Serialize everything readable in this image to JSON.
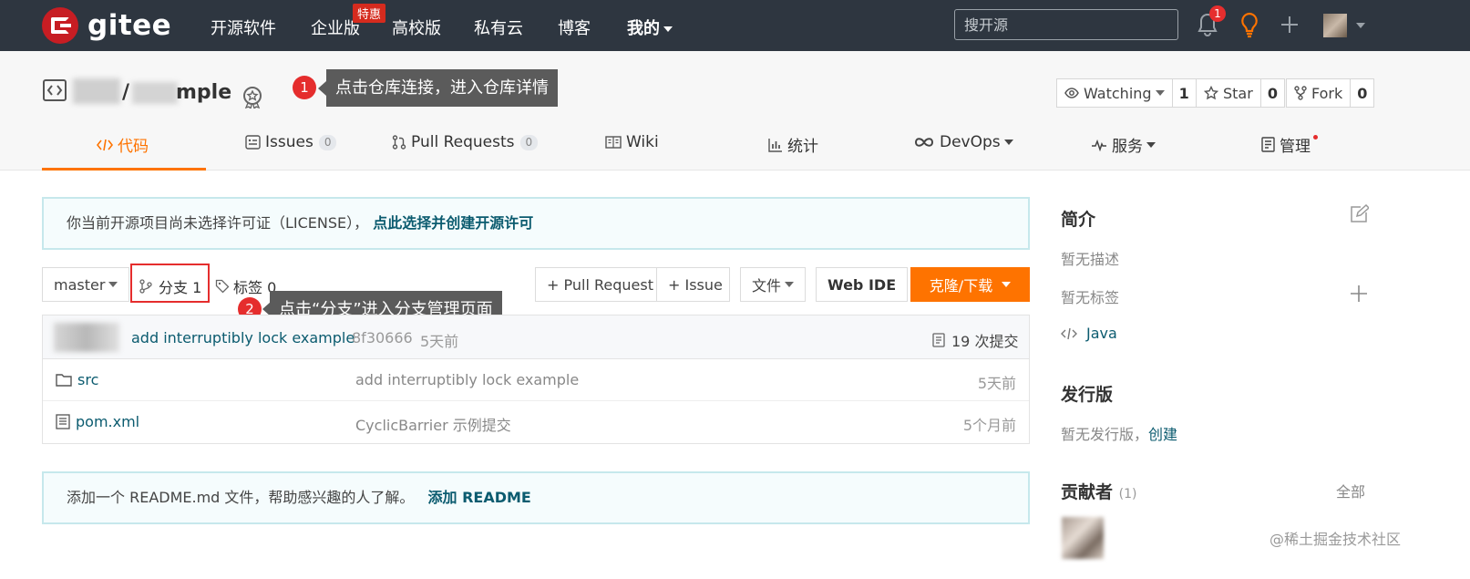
{
  "topnav": {
    "logo_text": "gitee",
    "items": [
      "开源软件",
      "企业版",
      "高校版",
      "私有云",
      "博客",
      "我的"
    ],
    "badge_te": "特惠",
    "search_placeholder": "搜开源",
    "notif_count": "1",
    "bg_color": "#2e3640"
  },
  "repo": {
    "name_suffix": "mple",
    "slash": "/",
    "watching_label": "Watching",
    "watching_count": "1",
    "star_label": "Star",
    "star_count": "0",
    "fork_label": "Fork",
    "fork_count": "0"
  },
  "tooltips": {
    "tip1_num": "1",
    "tip1_text": "点击仓库连接，进入仓库详情",
    "tip2_num": "2",
    "tip2_text": "点击“分支”进入分支管理页面"
  },
  "tabs": [
    {
      "label": "代码",
      "icon": "code-icon"
    },
    {
      "label": "Issues",
      "count": "0",
      "icon": "issues-icon"
    },
    {
      "label": "Pull Requests",
      "count": "0",
      "icon": "pull-request-icon"
    },
    {
      "label": "Wiki",
      "icon": "wiki-icon"
    },
    {
      "label": "统计",
      "icon": "chart-icon"
    },
    {
      "label": "DevOps",
      "icon": "infinity-icon"
    },
    {
      "label": "服务",
      "icon": "pulse-icon"
    },
    {
      "label": "管理",
      "icon": "manage-icon"
    }
  ],
  "license": {
    "text": "你当前开源项目尚未选择许可证（LICENSE），",
    "link": "点此选择并创建开源许可"
  },
  "toolbar": {
    "branch": "master",
    "branches": "分支 1",
    "tags": "标签 0",
    "pull_request": "+ Pull Request",
    "issue": "+ Issue",
    "file": "文件",
    "web_ide": "Web IDE",
    "clone": "克隆/下载"
  },
  "commit": {
    "message": "add interruptibly lock example",
    "sha": "8f30666",
    "time": "5天前",
    "count": "19 次提交"
  },
  "files": [
    {
      "name": "src",
      "type": "folder",
      "message": "add interruptibly lock example",
      "time": "5天前"
    },
    {
      "name": "pom.xml",
      "type": "file",
      "message": "CyclicBarrier 示例提交",
      "time": "5个月前"
    }
  ],
  "readme": {
    "text": "添加一个 README.md 文件，帮助感兴趣的人了解。",
    "link": "添加 README"
  },
  "sidebar": {
    "intro_title": "简介",
    "no_desc": "暂无描述",
    "no_tags": "暂无标签",
    "language": "Java",
    "release_title": "发行版",
    "no_release": "暂无发行版，",
    "create": "创建",
    "contrib_title": "贡献者",
    "contrib_count": "(1)",
    "all": "全部"
  },
  "watermark": "@稀土掘金技术社区",
  "colors": {
    "accent": "#fe7300",
    "link": "#0b5b6f",
    "alert": "#e52d2d"
  }
}
